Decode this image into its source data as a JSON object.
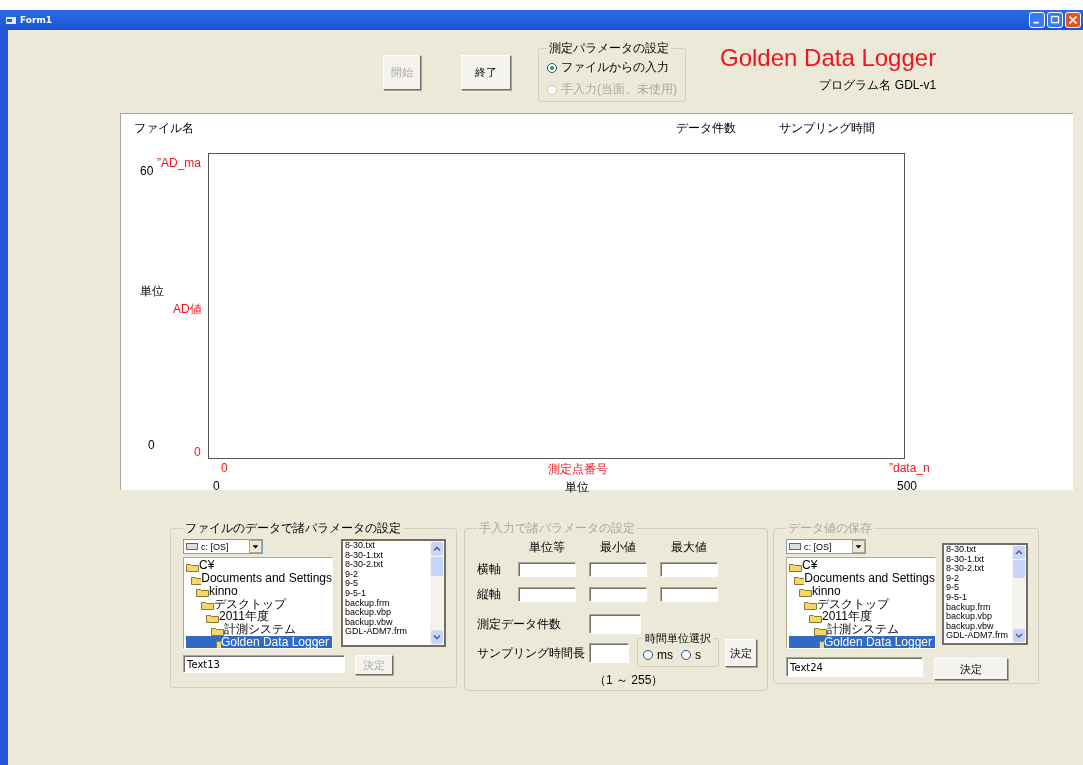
{
  "window": {
    "title": "Form1"
  },
  "top_buttons": [
    {
      "label": "開始",
      "disabled": true
    },
    {
      "label": "終了",
      "disabled": false
    }
  ],
  "input_mode": {
    "title": "測定パラメータの設定",
    "options": [
      {
        "label": "ファイルからの入力",
        "selected": true,
        "disabled": false
      },
      {
        "label": "手入力(当面、未使用)",
        "selected": false,
        "disabled": true
      }
    ]
  },
  "app_title": "Golden Data Logger",
  "program_name": "プログラム名 GDL-v1",
  "graph": {
    "file_name_label": "ファイル名",
    "data_count_label": "データ件数",
    "sampling_label": "サンプリング時間",
    "y_max": "60",
    "y_unit": "単位",
    "y_min": "0",
    "y_max_name": "”AD_ma",
    "y_name": "AD値",
    "y_min_red": "0",
    "x_min_red": "0",
    "x_name": "測定点番号",
    "x_max_name": "”data_n",
    "x_min": "0",
    "x_unit": "単位",
    "x_max": "500"
  },
  "file_group": {
    "title": "ファイルのデータで諸パラメータの設定",
    "disabled": false,
    "drive": "c: [OS]",
    "folders": [
      {
        "label": "C¥",
        "selected": false,
        "children": [
          {
            "label": "Documents and Settings",
            "selected": false,
            "children": [
              {
                "label": "kinno",
                "selected": false,
                "children": [
                  {
                    "label": "デスクトップ",
                    "selected": false,
                    "children": [
                      {
                        "label": "2011年度",
                        "selected": false,
                        "children": [
                          {
                            "label": "計測システム",
                            "selected": false,
                            "children": [
                              {
                                "label": "Golden Data Logger",
                                "selected": true
                              }
                            ]
                          }
                        ]
                      }
                    ]
                  }
                ]
              }
            ]
          }
        ]
      }
    ],
    "files": [
      "8-30.txt",
      "8-30-1.txt",
      "8-30-2.txt",
      "9-2",
      "9-5",
      "9-5-1",
      "backup.frm",
      "backup.vbp",
      "backup.vbw",
      "GDL-ADM7.frm"
    ],
    "field": "Text13",
    "button": {
      "label": "決定",
      "disabled": true
    }
  },
  "manual_group": {
    "title": "手入力で諸パラメータの設定",
    "disabled": true,
    "columns": [
      "単位等",
      "最小値",
      "最大値"
    ],
    "rows": [
      "横軸",
      "縦軸"
    ],
    "count_label": "測定データ件数",
    "sampling_label": "サンプリング時間長",
    "range": "（1 ～ 255）",
    "unit_group": {
      "title": "時間単位選択",
      "options": [
        {
          "label": "ms",
          "selected": false
        },
        {
          "label": "s",
          "selected": false
        }
      ]
    },
    "button": {
      "label": "決定",
      "disabled": false
    }
  },
  "save_group": {
    "title": "データ値の保存",
    "disabled": true,
    "drive": "c: [OS]",
    "folders": [
      {
        "label": "C¥",
        "selected": false,
        "children": [
          {
            "label": "Documents and Settings",
            "selected": false,
            "children": [
              {
                "label": "kinno",
                "selected": false,
                "children": [
                  {
                    "label": "デスクトップ",
                    "selected": false,
                    "children": [
                      {
                        "label": "2011年度",
                        "selected": false,
                        "children": [
                          {
                            "label": "計測システム",
                            "selected": false,
                            "children": [
                              {
                                "label": "Golden Data Logger",
                                "selected": true
                              }
                            ]
                          }
                        ]
                      }
                    ]
                  }
                ]
              }
            ]
          }
        ]
      }
    ],
    "files": [
      "8-30.txt",
      "8-30-1.txt",
      "8-30-2.txt",
      "9-2",
      "9-5",
      "9-5-1",
      "backup.frm",
      "backup.vbp",
      "backup.vbw",
      "GDL-ADM7.frm"
    ],
    "field": "Text24",
    "button": {
      "label": "決定",
      "disabled": false
    }
  }
}
